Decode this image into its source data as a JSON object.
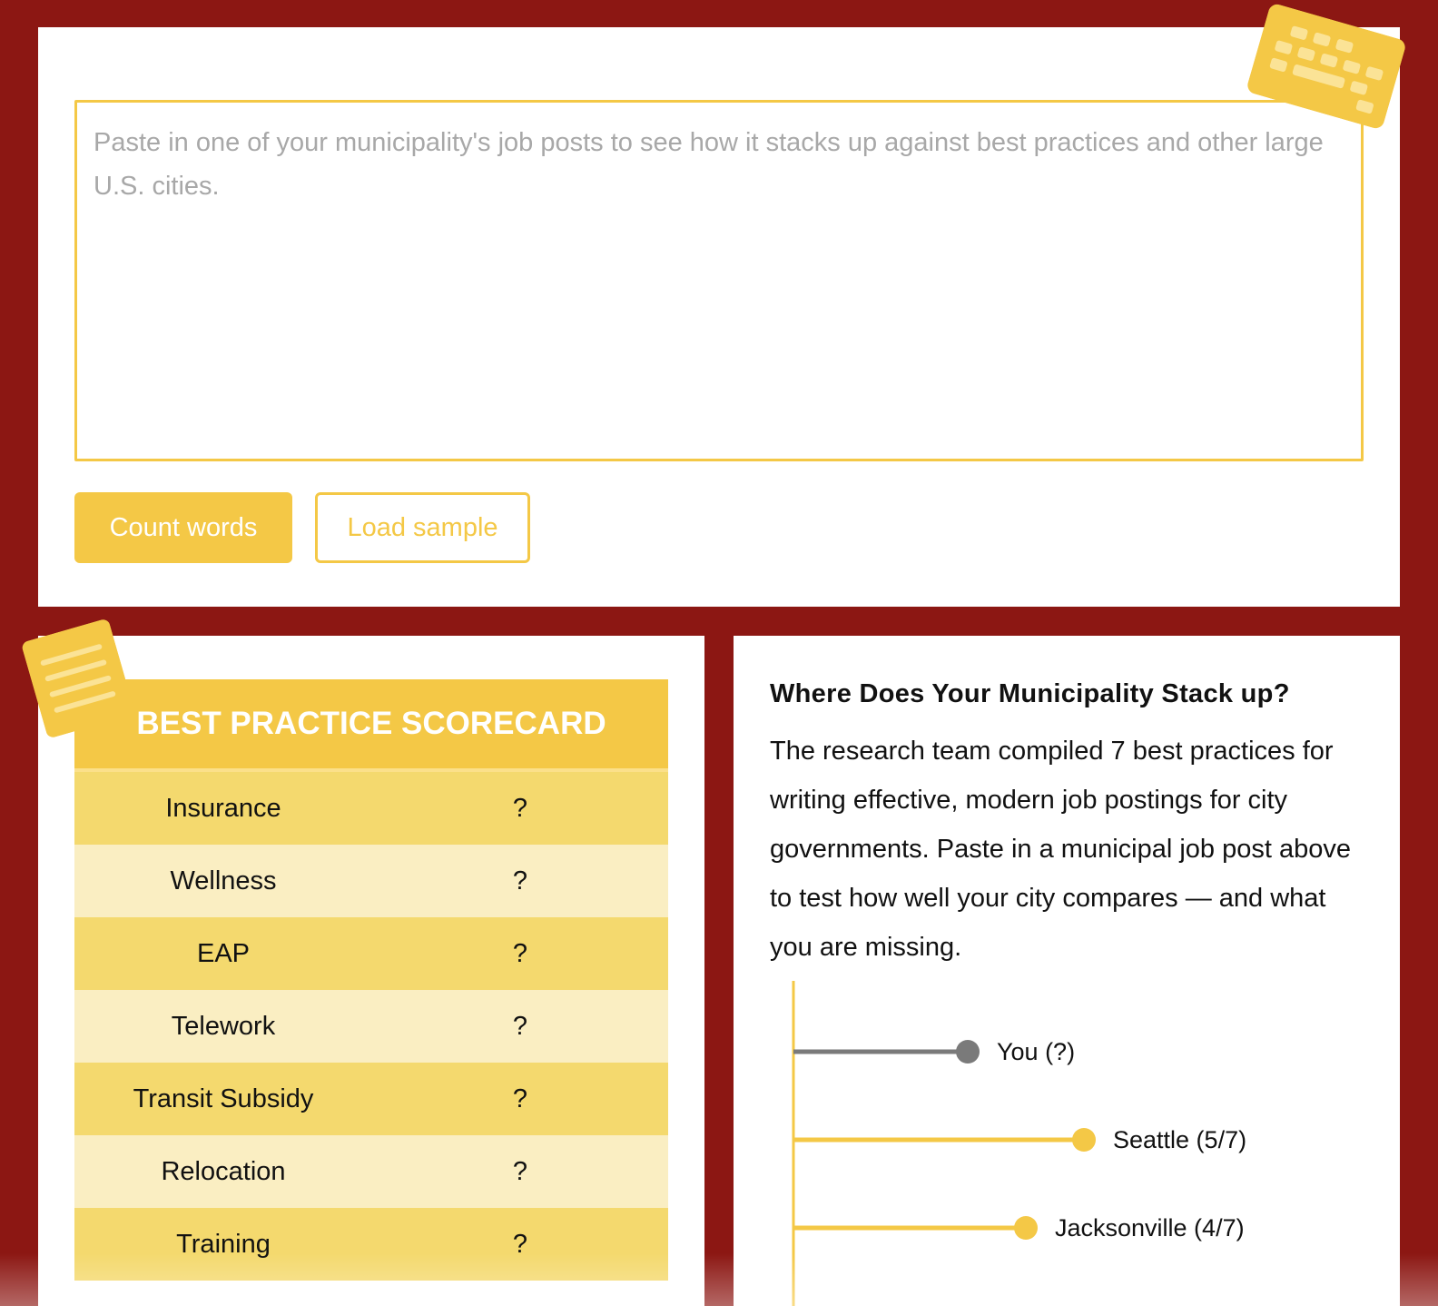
{
  "input": {
    "placeholder": "Paste in one of your municipality's job posts to see how it stacks up against best practices and other large U.S. cities.",
    "value": ""
  },
  "buttons": {
    "count_words": "Count words",
    "load_sample": "Load sample"
  },
  "icons": {
    "top": "keyboard-icon",
    "scorecard": "notes-icon"
  },
  "colors": {
    "background": "#8c1713",
    "accent": "#f4c846",
    "row_dark": "#f4d96e",
    "row_light": "#faeec2",
    "you_line": "#7a7a7a"
  },
  "scorecard": {
    "title": "Best Practice Scorecard",
    "rows": [
      {
        "label": "Insurance",
        "value": "?"
      },
      {
        "label": "Wellness",
        "value": "?"
      },
      {
        "label": "EAP",
        "value": "?"
      },
      {
        "label": "Telework",
        "value": "?"
      },
      {
        "label": "Transit Subsidy",
        "value": "?"
      },
      {
        "label": "Relocation",
        "value": "?"
      },
      {
        "label": "Training",
        "value": "?"
      }
    ]
  },
  "comparison": {
    "heading": "Where Does Your Municipality Stack up?",
    "intro": "The research team compiled 7 best practices for writing effective, modern job postings for city governments. Paste in a municipal job post above to test how well your city compares — and what you are missing."
  },
  "chart_data": {
    "type": "lollipop",
    "max": 7,
    "series": [
      {
        "label": "You (?)",
        "name": "You",
        "value": null,
        "color": "#7a7a7a"
      },
      {
        "label": "Seattle (5/7)",
        "name": "Seattle",
        "value": 5,
        "color": "#f4c846"
      },
      {
        "label": "Jacksonville (4/7)",
        "name": "Jacksonville",
        "value": 4,
        "color": "#f4c846"
      }
    ]
  }
}
